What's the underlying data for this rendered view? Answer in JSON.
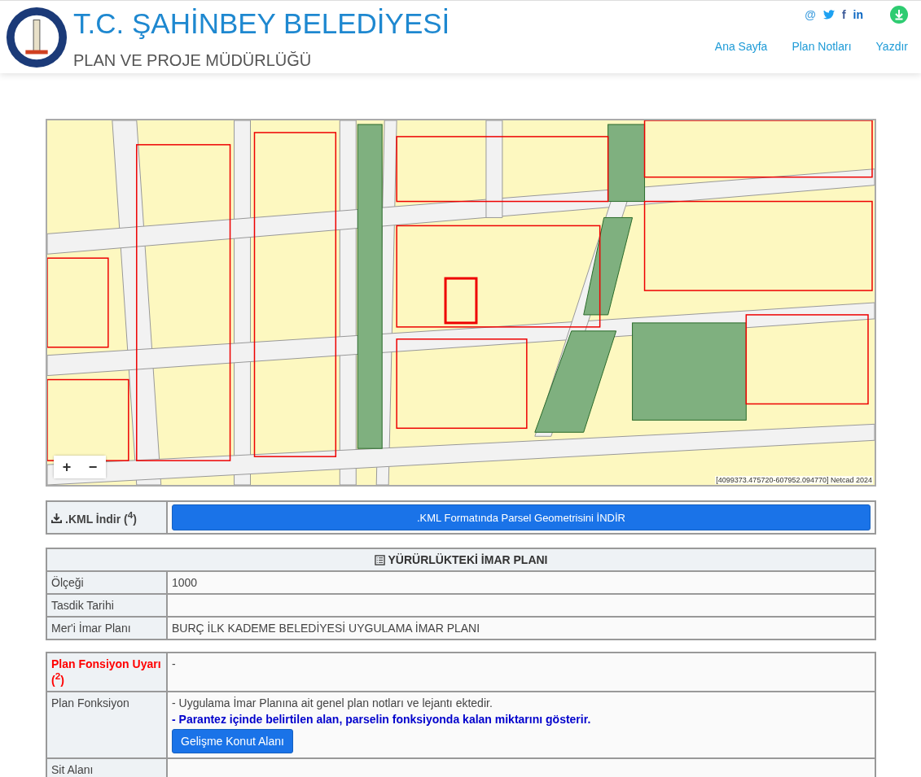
{
  "header": {
    "title": "T.C. ŞAHİNBEY BELEDİYESİ",
    "subtitle": "PLAN VE PROJE MÜDÜRLÜĞÜ",
    "social": [
      {
        "kind": "email",
        "label": "@"
      },
      {
        "kind": "twitter"
      },
      {
        "kind": "facebook",
        "label": "f"
      },
      {
        "kind": "linkedin",
        "label": "in"
      }
    ],
    "nav": [
      "Ana Sayfa",
      "Plan Notları",
      "Yazdır"
    ]
  },
  "map": {
    "zoom_in": "+",
    "zoom_out": "−",
    "attribution": "[4099373.475720-607952.094770] Netcad 2024"
  },
  "kml": {
    "label": ".KML İndir ($^{4}$)",
    "button": ".KML Formatında Parsel Geometrisini İNDİR"
  },
  "plan_table": {
    "title": "YÜRÜRLÜKTEKİ İMAR PLANI",
    "rows": [
      {
        "label": "Ölçeği",
        "value": "1000"
      },
      {
        "label": "Tasdik Tarihi",
        "value": ""
      },
      {
        "label": "Mer'i İmar Planı",
        "value": "BURÇ İLK KADEME BELEDİYESİ UYGULAMA İMAR PLANI"
      }
    ]
  },
  "function_table": {
    "rows": [
      {
        "kind": "warning",
        "label": "Plan Fonsiyon Uyarı ($^{2}$)",
        "value": "-"
      },
      {
        "kind": "function",
        "label": "Plan Fonksiyon",
        "note": "- Uygulama İmar Planına ait genel plan notları ve lejantı ektedir.",
        "emphasis": "- Parantez içinde belirtilen alan, parselin fonksiyonda kalan miktarını gösterir.",
        "button": "Gelişme Konut Alanı"
      },
      {
        "kind": "plain",
        "label": "Sit Alanı",
        "value": ""
      }
    ]
  }
}
